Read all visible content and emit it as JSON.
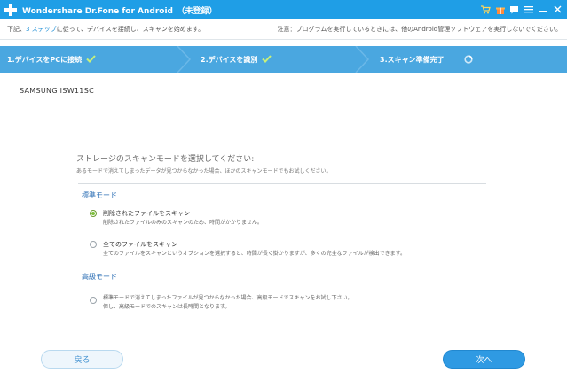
{
  "titlebar": {
    "title": "Wondershare Dr.Fone for Android　（未登録）",
    "icons": [
      "cart-icon",
      "gift-icon",
      "feedback-icon",
      "menu-icon",
      "minimize-icon",
      "close-icon"
    ]
  },
  "notice": {
    "prefix": "下記、",
    "link": "3 ステップ",
    "suffix": "に従って、デバイスを接続し、スキャンを始めます。",
    "right": "注意：プログラムを実行しているときには、他のAndroid管理ソフトウェアを実行しないでください。"
  },
  "steps": [
    {
      "label": "1.デバイスをPCに接続",
      "status": "done"
    },
    {
      "label": "2.デバイスを識別",
      "status": "done"
    },
    {
      "label": "3.スキャン準備完了",
      "status": "loading"
    }
  ],
  "device": {
    "name": "SAMSUNG ISW11SC"
  },
  "scan": {
    "heading": "ストレージのスキャンモードを選択してください:",
    "subheading": "あるモードで消えてしまったデータが見つからなかった場合、ほかのスキャンモードでもお試しください。",
    "standard_title": "標準モード",
    "options": [
      {
        "label": "削除されたファイルをスキャン",
        "desc": "削除されたファイルのみのスキャンのため、時間がかかりません。",
        "selected": true
      },
      {
        "label": "全てのファイルをスキャン",
        "desc": "全てのファイルをスキャンというオプションを選択すると、時間が長く掛かりますが、多くの完全なファイルが検出できます。",
        "selected": false
      }
    ],
    "advanced_title": "高級モード",
    "advanced_option": {
      "desc1": "標準モードで消えてしまったファイルが見つからなかった場合、高級モードでスキャンをお試し下さい。",
      "desc2": "但し、高級モードでのスキャンは長時間となります。",
      "selected": false
    }
  },
  "buttons": {
    "back": "戻る",
    "next": "次へ"
  },
  "colors": {
    "titlebar": "#1f9ee6",
    "steps": "#4aa7e0",
    "check": "#c8f07a",
    "radio_selected": "#7cc03a"
  }
}
